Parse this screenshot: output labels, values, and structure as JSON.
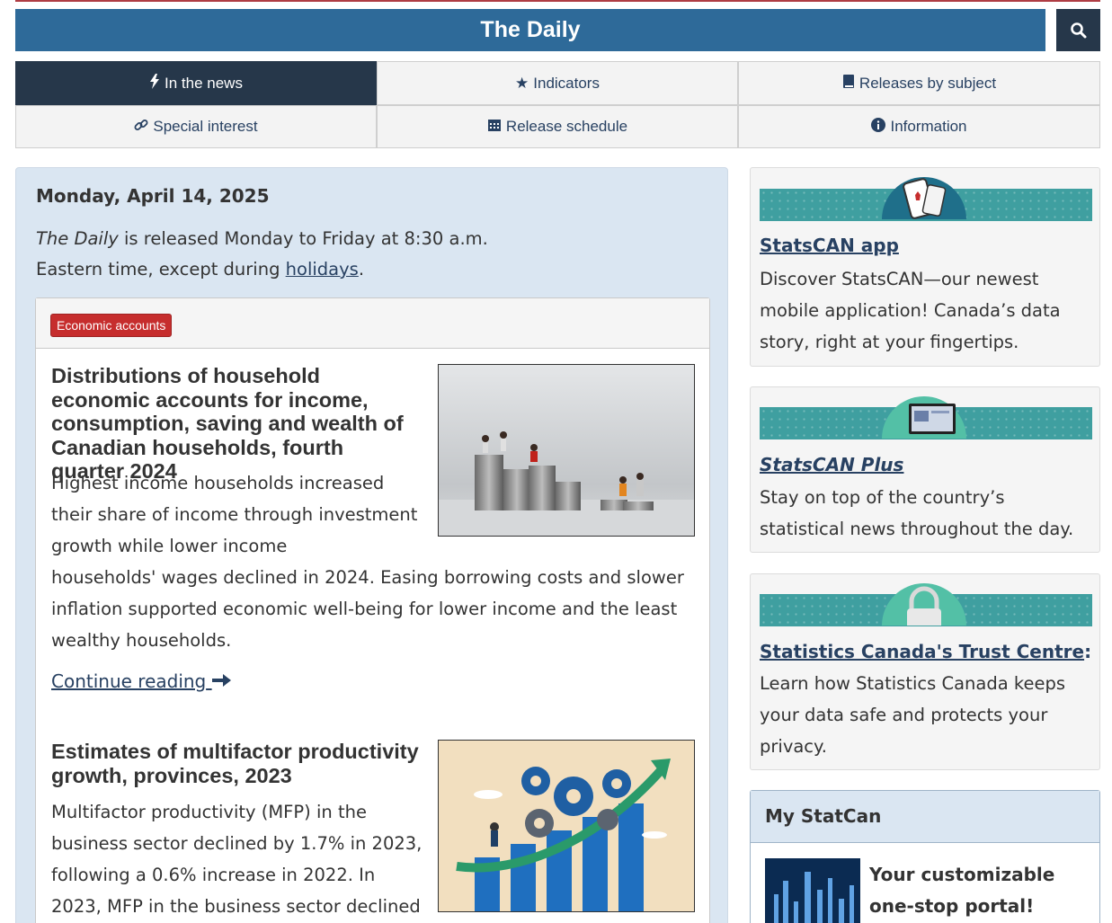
{
  "header": {
    "title": "The Daily",
    "search_icon": "search-icon"
  },
  "nav": [
    {
      "label": "In the news",
      "icon": "bolt-icon",
      "active": true
    },
    {
      "label": "Indicators",
      "icon": "star-icon",
      "active": false
    },
    {
      "label": "Releases by subject",
      "icon": "book-icon",
      "active": false
    },
    {
      "label": "Special interest",
      "icon": "link-icon",
      "active": false
    },
    {
      "label": "Release schedule",
      "icon": "calendar-icon",
      "active": false
    },
    {
      "label": "Information",
      "icon": "info-icon",
      "active": false
    }
  ],
  "main": {
    "date": "Monday, April 14, 2025",
    "intro_pub": "The Daily",
    "intro_line1": " is released Monday to Friday at 8:30 a.m.",
    "intro_line2": "Eastern time, except during ",
    "intro_link": "holidays",
    "intro_end": ".",
    "badge": "Economic accounts",
    "articles": [
      {
        "title": "Distributions of household economic accounts for income, consumption, saving and wealth of Canadian households, fourth quarter 2024",
        "text_wrapped": "Highest income households increased their share of income through investment growth while lower income",
        "text_full": "households' wages declined in 2024. Easing borrowing costs and slower inflation supported economic well-being for lower income and the least wealthy households.",
        "continue": "Continue reading",
        "image": "coin-stacks-figurines-image"
      },
      {
        "title": "Estimates of multifactor productivity growth, provinces, 2023",
        "text_wrapped": "Multifactor productivity (MFP) in the business sector declined by 1.7% in 2023, following a 0.6% increase in 2022. In 2023, MFP in the business sector declined",
        "image": "gears-growth-arrow-image"
      }
    ]
  },
  "sidebar": {
    "promos": [
      {
        "link": "StatsCAN app",
        "text": "Discover StatsCAN—our newest mobile application! Canada’s data story, right at your fingertips.",
        "image": "phone-app-image"
      },
      {
        "link": "StatsCAN Plus",
        "text": "Stay on top of the country’s statistical news throughout the day.",
        "image": "laptop-image"
      },
      {
        "link": "Statistics Canada's Trust Centre",
        "link_suffix": ":",
        "text": "Learn how Statistics Canada keeps your data safe and protects your privacy.",
        "image": "padlock-image"
      }
    ],
    "mystatcan": {
      "heading": "My StatCan",
      "text": "Your customizable one-stop portal!",
      "image": "city-skyline-image"
    }
  },
  "colors": {
    "header_blue": "#2e6a99",
    "nav_active": "#26374a",
    "badge_red": "#c62d2d",
    "link": "#284162",
    "main_bg": "#dae6f2",
    "promo_teal": "#3f9fa0"
  }
}
